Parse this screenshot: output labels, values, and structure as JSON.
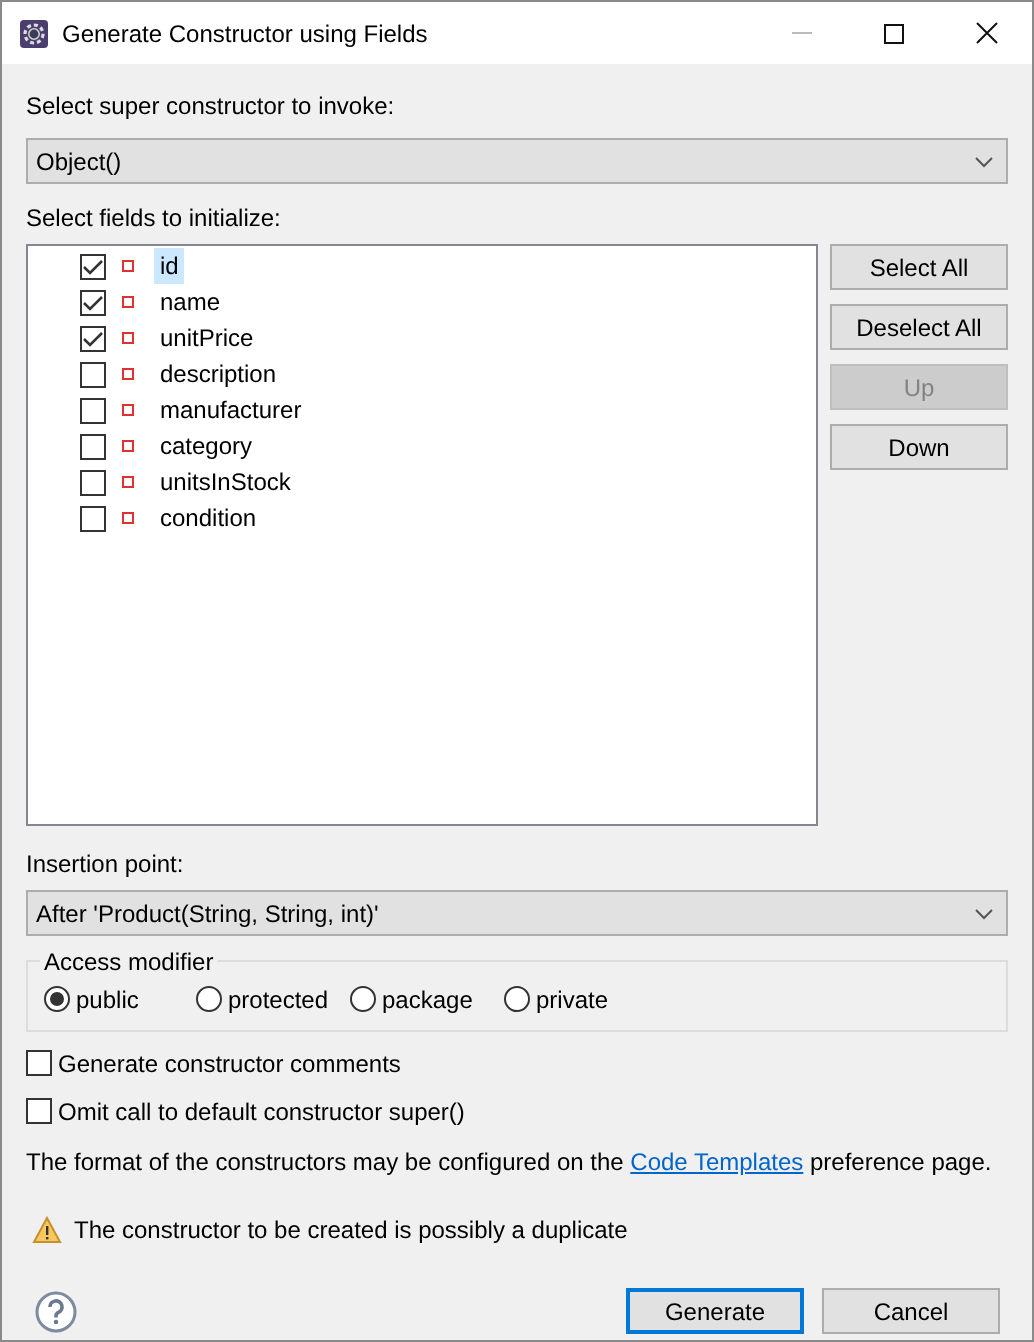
{
  "window": {
    "title": "Generate Constructor using Fields"
  },
  "super_constructor": {
    "label": "Select super constructor to invoke:",
    "value": "Object()"
  },
  "fields_label": "Select fields to initialize:",
  "fields": [
    {
      "name": "id",
      "checked": true,
      "selected": true
    },
    {
      "name": "name",
      "checked": true,
      "selected": false
    },
    {
      "name": "unitPrice",
      "checked": true,
      "selected": false
    },
    {
      "name": "description",
      "checked": false,
      "selected": false
    },
    {
      "name": "manufacturer",
      "checked": false,
      "selected": false
    },
    {
      "name": "category",
      "checked": false,
      "selected": false
    },
    {
      "name": "unitsInStock",
      "checked": false,
      "selected": false
    },
    {
      "name": "condition",
      "checked": false,
      "selected": false
    }
  ],
  "side_buttons": [
    {
      "label": "Select All",
      "disabled": false
    },
    {
      "label": "Deselect All",
      "disabled": false
    },
    {
      "label": "Up",
      "disabled": true
    },
    {
      "label": "Down",
      "disabled": false
    }
  ],
  "insertion_point": {
    "label": "Insertion point:",
    "value": "After 'Product(String, String, int)'"
  },
  "access_modifier": {
    "title": "Access modifier",
    "options": [
      {
        "label": "public",
        "selected": true
      },
      {
        "label": "protected",
        "selected": false
      },
      {
        "label": "package",
        "selected": false
      },
      {
        "label": "private",
        "selected": false
      }
    ]
  },
  "options": [
    {
      "label": "Generate constructor comments",
      "checked": false
    },
    {
      "label": "Omit call to default constructor super()",
      "checked": false
    }
  ],
  "info": {
    "before": "The format of the constructors may be configured on the",
    "link": "Code Templates",
    "after": "preference page."
  },
  "warning": "The constructor to be created is possibly a duplicate",
  "buttons": [
    {
      "label": "Generate",
      "default": true
    },
    {
      "label": "Cancel",
      "default": false
    }
  ]
}
